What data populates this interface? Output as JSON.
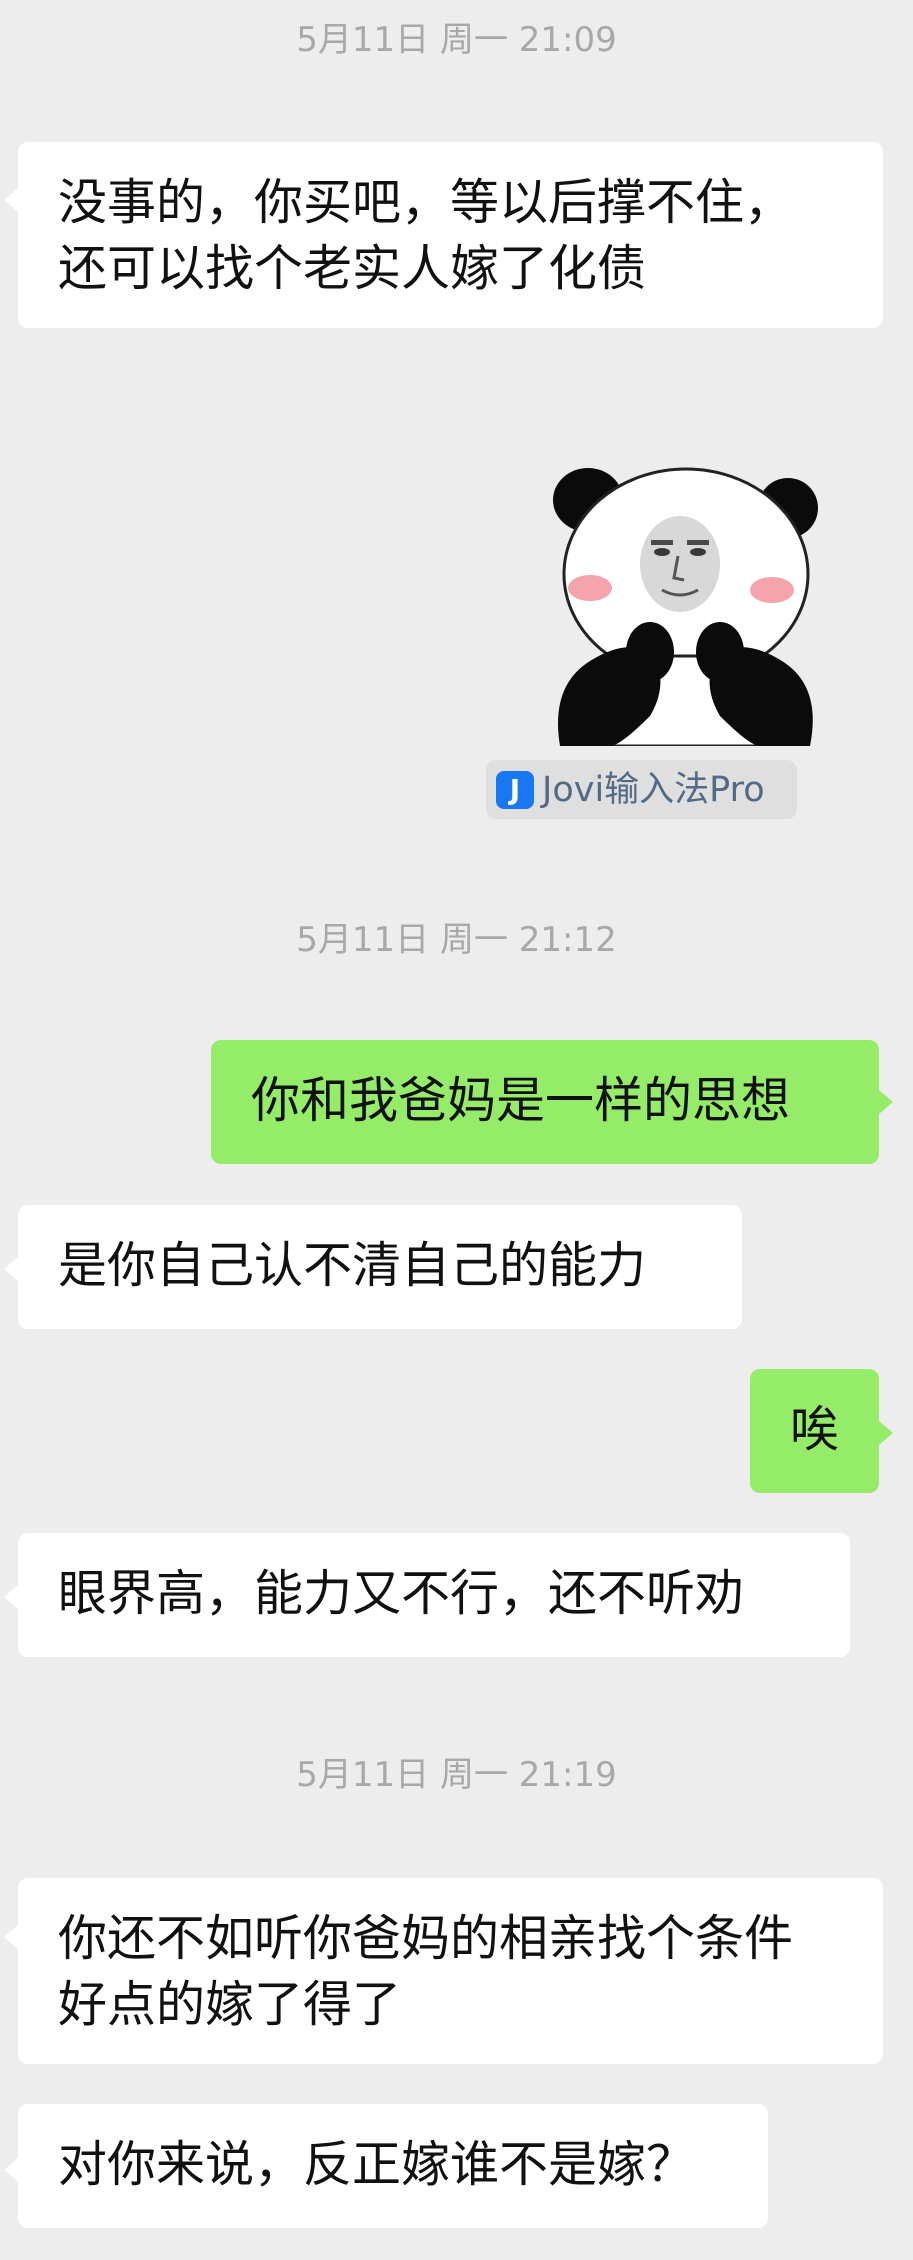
{
  "chat": {
    "timestamps": [
      "5月11日 周一 21:09",
      "5月11日 周一 21:12",
      "5月11日 周一 21:19"
    ],
    "messages": [
      {
        "side": "left",
        "lines": [
          "没事的，你买吧，等以后撑不住，",
          "还可以找个老实人嫁了化债"
        ]
      },
      {
        "side": "left",
        "kind": "sticker",
        "sticker": "panda-meme-sticker"
      },
      {
        "side": "right",
        "lines": [
          "你和我爸妈是一样的思想"
        ]
      },
      {
        "side": "left",
        "lines": [
          "是你自己认不清自己的能力"
        ]
      },
      {
        "side": "right",
        "lines": [
          "唉"
        ]
      },
      {
        "side": "left",
        "lines": [
          "眼界高，能力又不行，还不听劝"
        ]
      },
      {
        "side": "left",
        "lines": [
          "你还不如听你爸妈的相亲找个条件",
          "好点的嫁了得了"
        ]
      },
      {
        "side": "left",
        "lines": [
          "对你来说，反正嫁谁不是嫁？"
        ]
      }
    ],
    "sticker_source": {
      "icon_glyph": "J",
      "label": "Jovi输入法Pro",
      "icon_color": "#1877f2"
    }
  },
  "colors": {
    "background": "#ededed",
    "incoming_bubble": "#ffffff",
    "outgoing_bubble": "#95ec69",
    "timestamp_text": "#a8a8a8"
  }
}
